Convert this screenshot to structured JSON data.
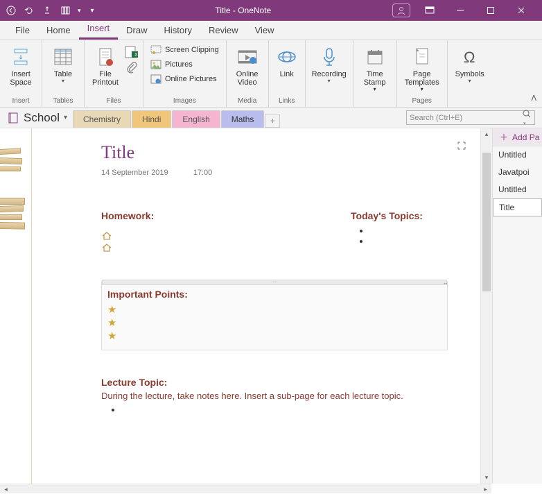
{
  "window": {
    "title": "Title  -  OneNote"
  },
  "menus": {
    "file": "File",
    "home": "Home",
    "insert": "Insert",
    "draw": "Draw",
    "history": "History",
    "review": "Review",
    "view": "View"
  },
  "ribbon": {
    "insert_space": "Insert\nSpace",
    "table": "Table",
    "file_printout": "File\nPrintout",
    "screen_clipping": "Screen Clipping",
    "pictures": "Pictures",
    "online_pictures": "Online Pictures",
    "online_video": "Online\nVideo",
    "link": "Link",
    "recording": "Recording",
    "time_stamp": "Time\nStamp",
    "page_templates": "Page\nTemplates",
    "symbols": "Symbols",
    "g_insert": "Insert",
    "g_tables": "Tables",
    "g_files": "Files",
    "g_images": "Images",
    "g_media": "Media",
    "g_links": "Links",
    "g_pages": "Pages"
  },
  "notebook": {
    "name": "School",
    "sections": {
      "chemistry": "Chemistry",
      "hindi": "Hindi",
      "english": "English",
      "maths": "Maths"
    }
  },
  "search": {
    "placeholder": "Search (Ctrl+E)"
  },
  "page": {
    "title": "Title",
    "date": "14 September 2019",
    "time": "17:00",
    "homework": "Homework:",
    "todays_topics": "Today's Topics:",
    "important_points": "Important Points:",
    "lecture_topic": "Lecture Topic:",
    "lecture_body": "During the lecture, take notes here.  Insert a sub-page for each lecture topic."
  },
  "sidepanel": {
    "add_page": "Add Pa",
    "items": [
      "Untitled",
      "Javatpoi",
      "Untitled",
      "Title"
    ]
  }
}
